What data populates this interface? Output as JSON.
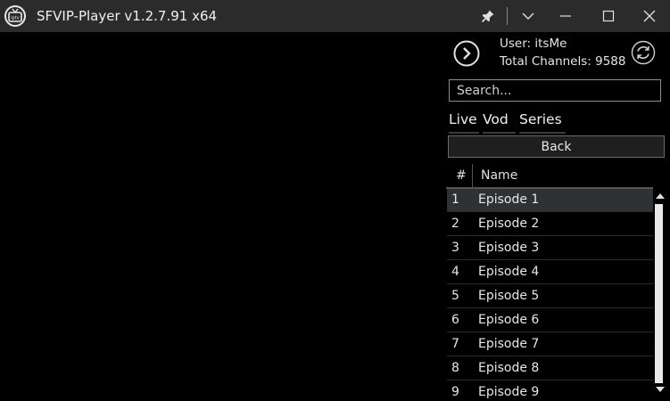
{
  "window": {
    "title": "SFVIP-Player v1.2.7.91 x64",
    "icons": [
      "tv-logo-icon",
      "pin-icon",
      "chevron-down-icon",
      "minimize-icon",
      "maximize-icon",
      "close-icon"
    ]
  },
  "account": {
    "user_label": "User:",
    "user_value": "itsMe",
    "channels_label": "Total Channels:",
    "channels_value": "9588"
  },
  "search": {
    "placeholder": "Search...",
    "value": ""
  },
  "tabs": [
    {
      "label": "Live"
    },
    {
      "label": "Vod"
    },
    {
      "label": "Series"
    }
  ],
  "back_label": "Back",
  "table": {
    "columns": [
      "#",
      "Name"
    ],
    "rows": [
      {
        "num": "1",
        "name": "Episode 1",
        "selected": true
      },
      {
        "num": "2",
        "name": "Episode 2"
      },
      {
        "num": "3",
        "name": "Episode 3"
      },
      {
        "num": "4",
        "name": "Episode 4"
      },
      {
        "num": "5",
        "name": "Episode 5"
      },
      {
        "num": "6",
        "name": "Episode 6"
      },
      {
        "num": "7",
        "name": "Episode 7"
      },
      {
        "num": "8",
        "name": "Episode 8"
      },
      {
        "num": "9",
        "name": "Episode 9"
      }
    ]
  },
  "colors": {
    "titlebar": "#2b2b2b",
    "background": "#000000",
    "selected_row": "#2f3134",
    "text": "#e6e6e6"
  }
}
